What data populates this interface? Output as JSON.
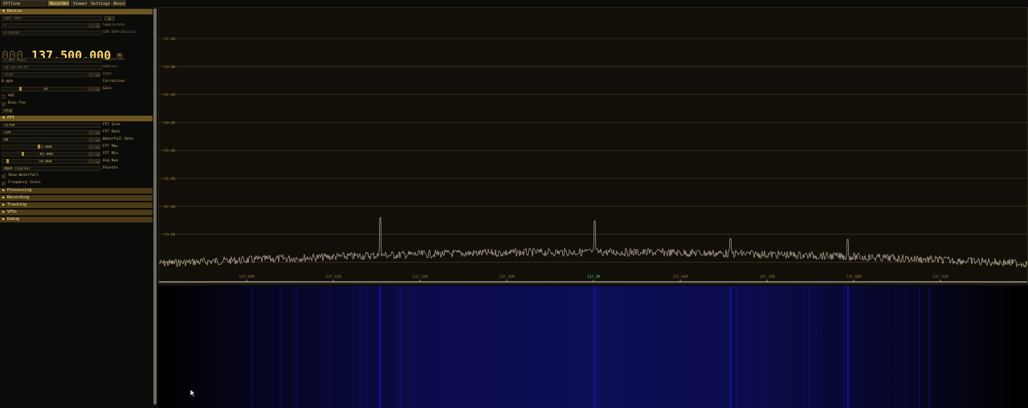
{
  "menu": {
    "tabs": [
      "Offline processing",
      "Recorder",
      "Viewer",
      "Settings",
      "About"
    ],
    "active_tab": "Recorder"
  },
  "device": {
    "header": "▼ Device",
    "source": "SDR: RSP",
    "samplerate_field": "s",
    "samplerate_label": "Samplerate",
    "serial_field": "4-S4444",
    "serial_label": "SDR  HSP+/Disco3",
    "frequency_dim": "000.",
    "frequency": "137.500.000",
    "frequency_unit": "Hz",
    "rate_field": "2.4Ms Msps",
    "rate_label": "Samplerate",
    "address_field": "10.10.10.95",
    "address_label": "Address",
    "path_field": "1234",
    "path_label": "Path",
    "correction_field": "0 ppm",
    "correction_label": "Correction",
    "gain_value": "10",
    "gain_label": "Gain",
    "agc_label": "AGC",
    "bias_label": "Bias-Tee",
    "stop_label": "Stop"
  },
  "fft": {
    "header": "▼ FFT",
    "size_value": "32768",
    "size_label": "FFT Size",
    "rate_value": "120",
    "rate_label": "FFT Rate",
    "wf_rate_value": "60",
    "wf_rate_label": "Waterfall Rate",
    "max_value": "-5.000",
    "max_label": "FFT Max",
    "min_value": "-85.000",
    "min_label": "FFT Min",
    "avg_value": "10.000",
    "avg_label": "Avg Num",
    "palette_value": "WQBX (cycle)",
    "palette_label": "Palette",
    "show_wf_label": "Show Waterfall",
    "freq_scale_label": "Frequency Scale"
  },
  "sections": [
    "▶ Processing",
    "▶ Recording",
    "▶ Tracking",
    "▶ VFOs",
    "▶ Debug"
  ],
  "plot": {
    "y_ticks": [
      "-21.00",
      "-33.00",
      "-41.00",
      "-49.00",
      "-55.00",
      "-61.00",
      "-67.00",
      "-73.00",
      "-79.00"
    ],
    "x_ticks": [
      "137.09M",
      "137.15M",
      "137.22M",
      "137.26M",
      "137.5M",
      "137.64M",
      "137.76M",
      "137.86M",
      "137.91M"
    ],
    "center_index": 4,
    "peaks": [
      0.255,
      0.502,
      0.658,
      0.793
    ],
    "colors": {
      "grid": "#4a4020",
      "trace": "#cfc6ad",
      "tick": "#8c7b44",
      "center": "#4fd07a",
      "waterfall_dark": "#05051a",
      "waterfall_blue": "#13138a"
    }
  }
}
